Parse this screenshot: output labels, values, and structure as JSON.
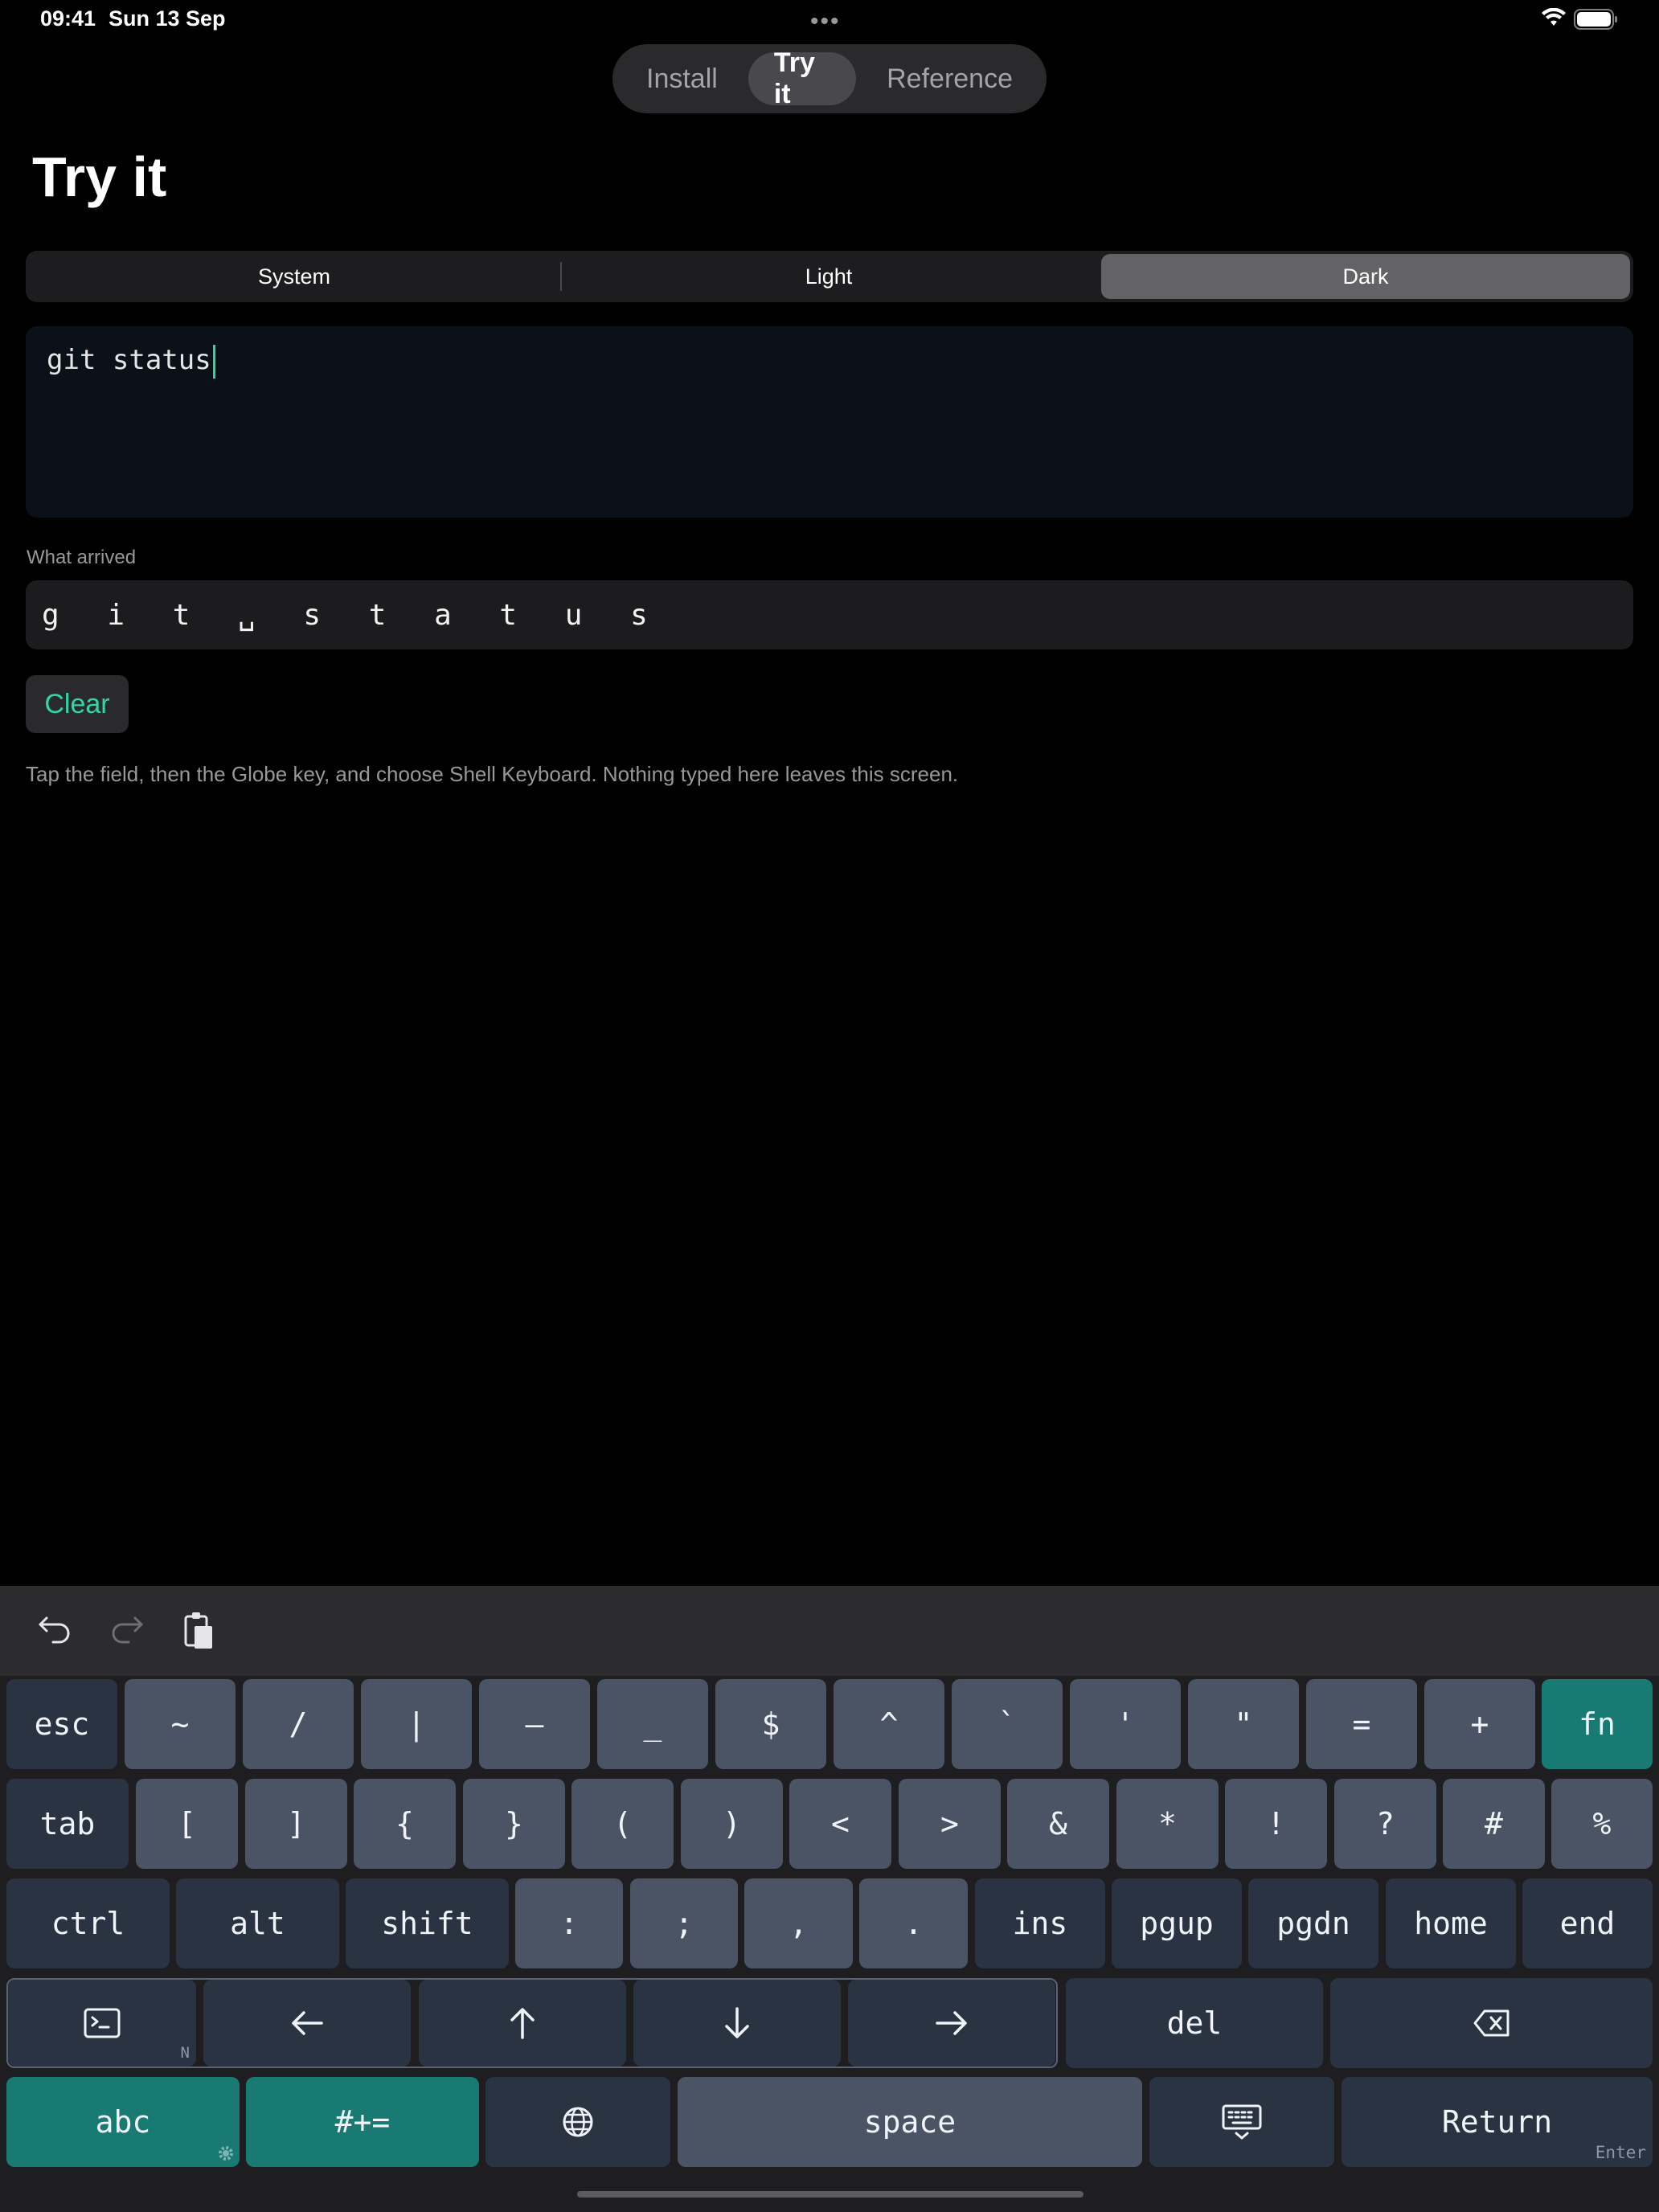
{
  "status_bar": {
    "time": "09:41",
    "date": "Sun 13 Sep"
  },
  "top_tabs": [
    {
      "label": "Install",
      "active": false
    },
    {
      "label": "Try it",
      "active": true
    },
    {
      "label": "Reference",
      "active": false
    }
  ],
  "page_title": "Try it",
  "theme": {
    "options": [
      "System",
      "Light",
      "Dark"
    ],
    "selected": "Dark"
  },
  "input": {
    "value": "git status"
  },
  "arrived": {
    "label": "What arrived",
    "value": "g i t ␣ s t a t u s"
  },
  "clear_label": "Clear",
  "hint": "Tap the field, then the Globe key, and choose Shell Keyboard. Nothing typed here leaves this screen.",
  "keyboard": {
    "toolbar": [
      "undo-icon",
      "redo-icon",
      "paste-icon"
    ],
    "row1": [
      "esc",
      "~",
      "/",
      "|",
      "–",
      "_",
      "$",
      "^",
      "`",
      "'",
      "\"",
      "=",
      "+",
      "fn"
    ],
    "row2": [
      "tab",
      "[",
      "]",
      "{",
      "}",
      "(",
      ")",
      "<",
      ">",
      "&",
      "*",
      "!",
      "?",
      "#",
      "%"
    ],
    "row3": [
      "ctrl",
      "alt",
      "shift",
      ":",
      ";",
      ",",
      ".",
      "ins",
      "pgup",
      "pgdn",
      "home",
      "end"
    ],
    "row4": {
      "terminal_badge": "N",
      "del": "del"
    },
    "row5": {
      "abc": "abc",
      "symbols": "#+=",
      "space": "space",
      "return": "Return",
      "return_sub": "Enter"
    }
  },
  "colors": {
    "accent": "#30d6a4",
    "teal_key": "#187a73"
  }
}
